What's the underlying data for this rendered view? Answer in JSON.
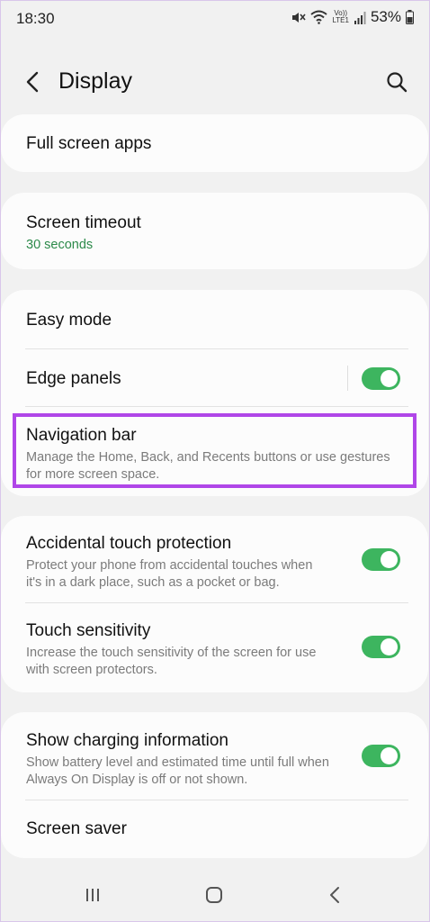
{
  "status_bar": {
    "time": "18:30",
    "battery_percent": "53%",
    "network_label_top": "Vo))",
    "network_label_bottom": "LTE1",
    "icons": [
      "mute-icon",
      "wifi-icon",
      "volte-icon",
      "signal-icon",
      "battery-icon"
    ]
  },
  "header": {
    "title": "Display",
    "back_icon": "back-arrow-icon",
    "search_icon": "search-icon"
  },
  "settings": {
    "full_screen_apps": {
      "label": "Full screen apps"
    },
    "screen_timeout": {
      "label": "Screen timeout",
      "value": "30 seconds"
    },
    "easy_mode": {
      "label": "Easy mode"
    },
    "edge_panels": {
      "label": "Edge panels",
      "enabled": true
    },
    "navigation_bar": {
      "label": "Navigation bar",
      "description_line1": "Manage the Home, Back, and Recents buttons or use gestures",
      "description_line2": "for more screen space."
    },
    "accidental_touch": {
      "label": "Accidental touch protection",
      "description_line1": "Protect your phone from accidental touches when",
      "description_line2": "it's in a dark place, such as a pocket or bag.",
      "enabled": true
    },
    "touch_sensitivity": {
      "label": "Touch sensitivity",
      "description_line1": "Increase the touch sensitivity of the screen for use",
      "description_line2": "with screen protectors.",
      "enabled": true
    },
    "charging_info": {
      "label": "Show charging information",
      "description_line1": "Show battery level and estimated time until full when",
      "description_line2": "Always On Display is off or not shown.",
      "enabled": true
    },
    "screen_saver": {
      "label": "Screen saver"
    }
  },
  "colors": {
    "accent_green": "#3db55f",
    "value_green": "#2c8a4a",
    "highlight_purple": "#b046e8",
    "background": "#f1f1f1",
    "card": "#fcfcfc"
  },
  "nav_bar": {
    "icons": [
      "recents-icon",
      "home-icon",
      "back-nav-icon"
    ]
  }
}
